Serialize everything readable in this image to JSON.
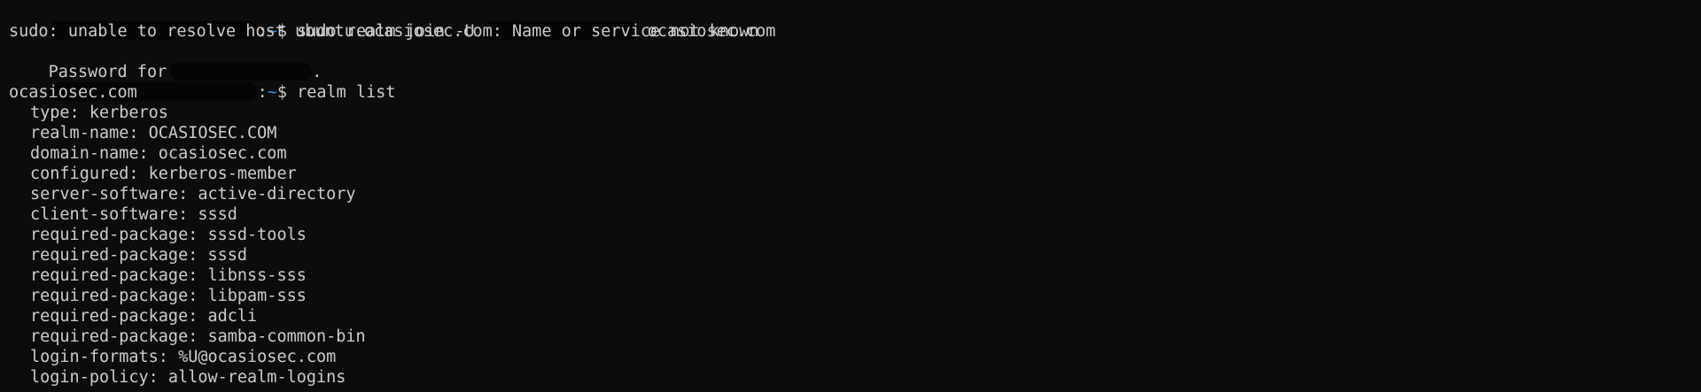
{
  "terminal": {
    "cmd1": {
      "prompt_colon": ":",
      "prompt_path": "~",
      "prompt_symbol": "$",
      "command": " sudo realm join -U",
      "domain_arg": " ocasiosec.com"
    },
    "error_line": "sudo: unable to resolve host ubuntu.ocasiosec.com: Name or service not known",
    "password_prefix": "Password for",
    "password_suffix": ".",
    "cmd2": {
      "prompt_colon": ":",
      "prompt_path": "~",
      "prompt_symbol": "$",
      "command": " realm list"
    },
    "realm_header": "ocasiosec.com",
    "realm_properties": [
      "type: kerberos",
      "realm-name: OCASIOSEC.COM",
      "domain-name: ocasiosec.com",
      "configured: kerberos-member",
      "server-software: active-directory",
      "client-software: sssd",
      "required-package: sssd-tools",
      "required-package: sssd",
      "required-package: libnss-sss",
      "required-package: libpam-sss",
      "required-package: adcli",
      "required-package: samba-common-bin",
      "login-formats: %U@ocasiosec.com",
      "login-policy: allow-realm-logins"
    ]
  },
  "colors": {
    "background": "#0c0c0c",
    "text": "#cccccc",
    "path": "#3b8eea",
    "redaction": "#050505"
  }
}
